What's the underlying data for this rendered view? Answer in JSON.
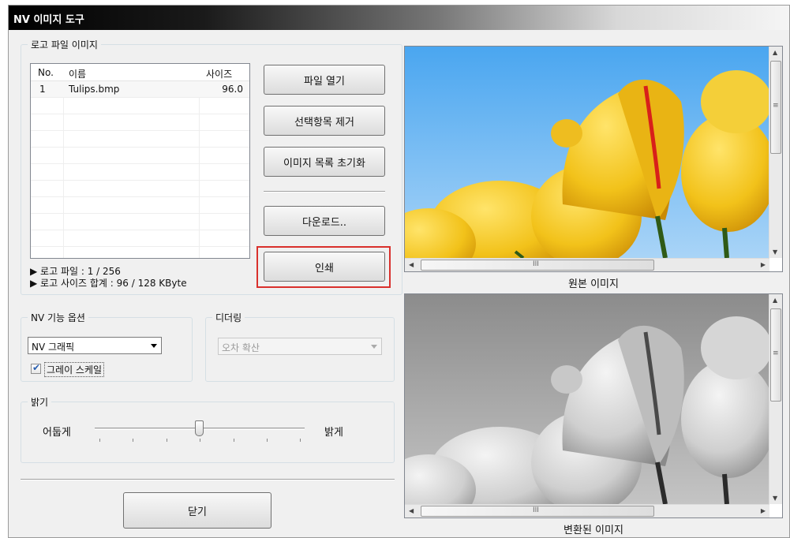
{
  "window": {
    "title": "NV 이미지 도구"
  },
  "logo_group": {
    "legend": "로고 파일 이미지",
    "list": {
      "columns": [
        "No.",
        "이름",
        "사이즈"
      ],
      "rows": [
        {
          "no": "1",
          "name": "Tulips.bmp",
          "size": "96.0"
        }
      ]
    },
    "info_files": "▶ 로고 파일 : 1 / 256",
    "info_size": "▶ 로고 사이즈 합계 : 96 / 128 KByte"
  },
  "buttons": {
    "open": "파일 열기",
    "remove": "선택항목 제거",
    "reset": "이미지 목록 초기화",
    "download": "다운로드..",
    "print": "인쇄",
    "close": "닫기"
  },
  "nv_options": {
    "legend": "NV 기능 옵션",
    "combo_value": "NV 그래픽",
    "grayscale_label": "그레이 스케일",
    "grayscale_checked": true
  },
  "dithering": {
    "legend": "디더링",
    "combo_value": "오차 확산"
  },
  "brightness": {
    "legend": "밝기",
    "left_label": "어둡게",
    "right_label": "밝게",
    "level": 0.5
  },
  "preview": {
    "original_caption": "원본 이미지",
    "converted_caption": "변환된 이미지",
    "scroll_grip": "III"
  },
  "colors": {
    "highlight_border": "#d9302c",
    "sky": "#4aa6f0",
    "petal": "#f2c21a"
  }
}
